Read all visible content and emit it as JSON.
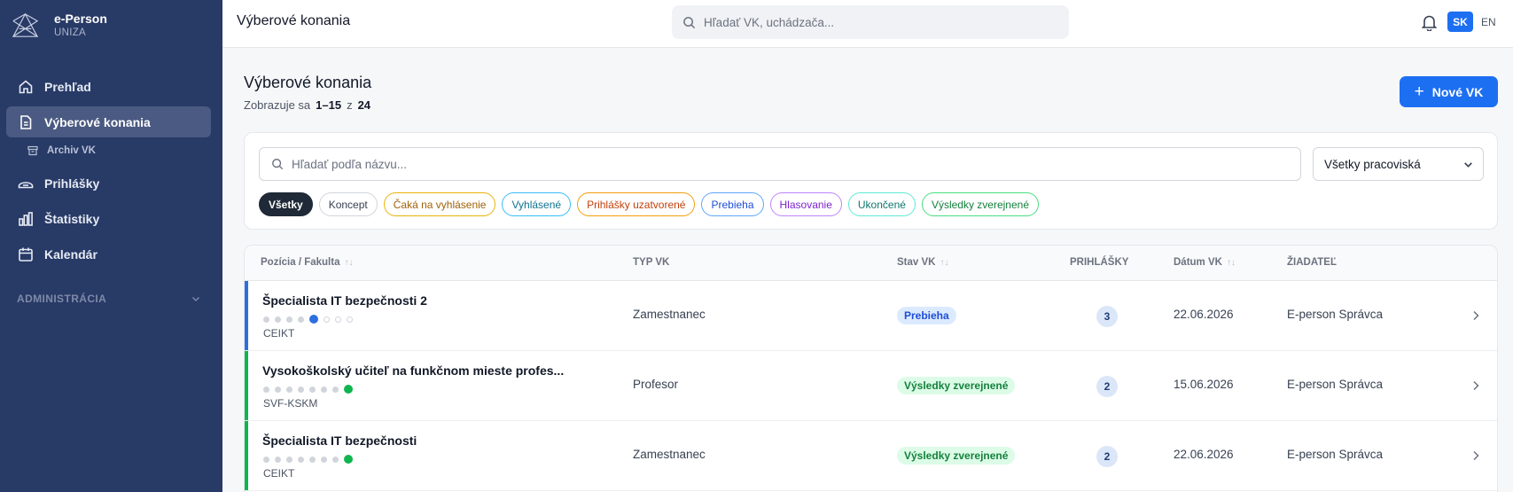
{
  "brand": {
    "name": "e-Person",
    "org": "UNIZA"
  },
  "sidebar": {
    "items": [
      {
        "label": "Prehľad",
        "icon": "home-icon"
      },
      {
        "label": "Výberové konania",
        "icon": "document-icon",
        "active": true
      },
      {
        "label": "Archiv VK",
        "icon": "archive-icon",
        "sub": true
      },
      {
        "label": "Prihlášky",
        "icon": "inbox-icon"
      },
      {
        "label": "Štatistiky",
        "icon": "bar-chart-icon"
      },
      {
        "label": "Kalendár",
        "icon": "calendar-icon"
      }
    ],
    "section": "ADMINISTRÁCIA"
  },
  "topbar": {
    "title": "Výberové konania",
    "search_placeholder": "Hľadať VK, uchádzača...",
    "lang_active": "SK",
    "lang_other": "EN"
  },
  "page": {
    "title": "Výberové konania",
    "count_prefix": "Zobrazuje sa",
    "count_range": "1–15",
    "count_sep": "z",
    "count_total": "24",
    "new_button": "Nové VK"
  },
  "filters": {
    "search_placeholder": "Hľadať podľa názvu...",
    "workplace_select": "Všetky pracoviská",
    "chips": [
      {
        "label": "Všetky",
        "active": true,
        "color": "#1f2937"
      },
      {
        "label": "Koncept",
        "color": "#374151",
        "border": "#d1d5db"
      },
      {
        "label": "Čaká na vyhlásenie",
        "color": "#a16207",
        "border": "#eab308"
      },
      {
        "label": "Vyhlásené",
        "color": "#0e7490",
        "border": "#38bdf8"
      },
      {
        "label": "Prihlášky uzatvorené",
        "color": "#c2410c",
        "border": "#f59e0b"
      },
      {
        "label": "Prebieha",
        "color": "#1d4ed8",
        "border": "#60a5fa"
      },
      {
        "label": "Hlasovanie",
        "color": "#7e22ce",
        "border": "#c084fc"
      },
      {
        "label": "Ukončené",
        "color": "#0f766e",
        "border": "#5eead4"
      },
      {
        "label": "Výsledky zverejnené",
        "color": "#15803d",
        "border": "#4ade80"
      }
    ]
  },
  "table": {
    "headers": {
      "position": "Pozícia / Fakulta",
      "type": "TYP VK",
      "status": "Stav VK",
      "applications": "PRIHLÁŠKY",
      "date": "Dátum VK",
      "requester": "ŽIADATEĽ"
    },
    "rows": [
      {
        "title": "Špecialista IT bezpečnosti 2",
        "code": "CEIKT",
        "type": "Zamestnanec",
        "status": "Prebieha",
        "status_color": "#1d4ed8",
        "status_bg": "#dbeafe",
        "accent": "#2e6fe0",
        "progress_step": 5,
        "progress_total": 8,
        "applications": "3",
        "date": "22.06.2026",
        "requester": "E-person Správca"
      },
      {
        "title": "Vysokoškolský učiteľ na funkčnom mieste profes...",
        "code": "SVF-KSKM",
        "type": "Profesor",
        "status": "Výsledky zverejnené",
        "status_color": "#15803d",
        "status_bg": "#dcfce7",
        "accent": "#10b54f",
        "progress_step": 8,
        "progress_total": 8,
        "applications": "2",
        "date": "15.06.2026",
        "requester": "E-person Správca"
      },
      {
        "title": "Špecialista IT bezpečnosti",
        "code": "CEIKT",
        "type": "Zamestnanec",
        "status": "Výsledky zverejnené",
        "status_color": "#15803d",
        "status_bg": "#dcfce7",
        "accent": "#10b54f",
        "progress_step": 8,
        "progress_total": 8,
        "applications": "2",
        "date": "22.06.2026",
        "requester": "E-person Správca"
      }
    ]
  },
  "colors": {
    "sidebar": "#283a66",
    "primary": "#1d6ff2"
  }
}
